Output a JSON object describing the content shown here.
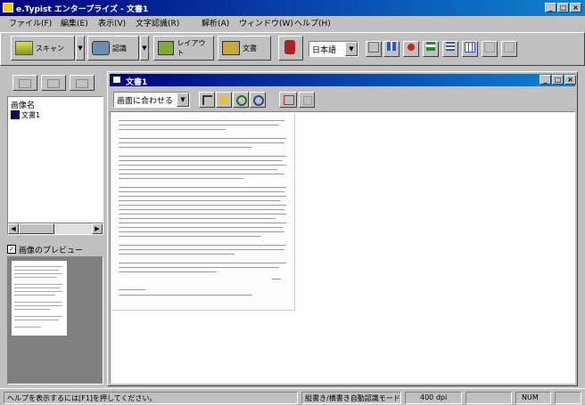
{
  "window": {
    "title": "e.Typist エンタープライズ - 文書1"
  },
  "menu": [
    "ファイル(F)",
    "編集(E)",
    "表示(V)",
    "文字認識(R)",
    "解析(A)",
    "ウィンドウ(W)",
    "ヘルプ(H)"
  ],
  "toolbar": {
    "btn1_label": "スキャン",
    "btn2_label": "認識",
    "btn3_label": "レイアウト",
    "btn4_label": "文書",
    "mode_select": "日本語"
  },
  "left_panel": {
    "header": "画像名",
    "item_label": "文書1",
    "preview_label": "画像のプレビュー"
  },
  "doc_window": {
    "title": "文書1",
    "zoom_select": "画面に合わせる"
  },
  "statusbar": {
    "help": "ヘルプを表示するには[F1]を押してください。",
    "mode": "縦書き/横書き自動認識モード",
    "dpi": "400 dpi",
    "num": "NUM"
  },
  "colors": {
    "title_start": "#000080",
    "title_end": "#1084d0",
    "face": "#c0c0c0"
  }
}
